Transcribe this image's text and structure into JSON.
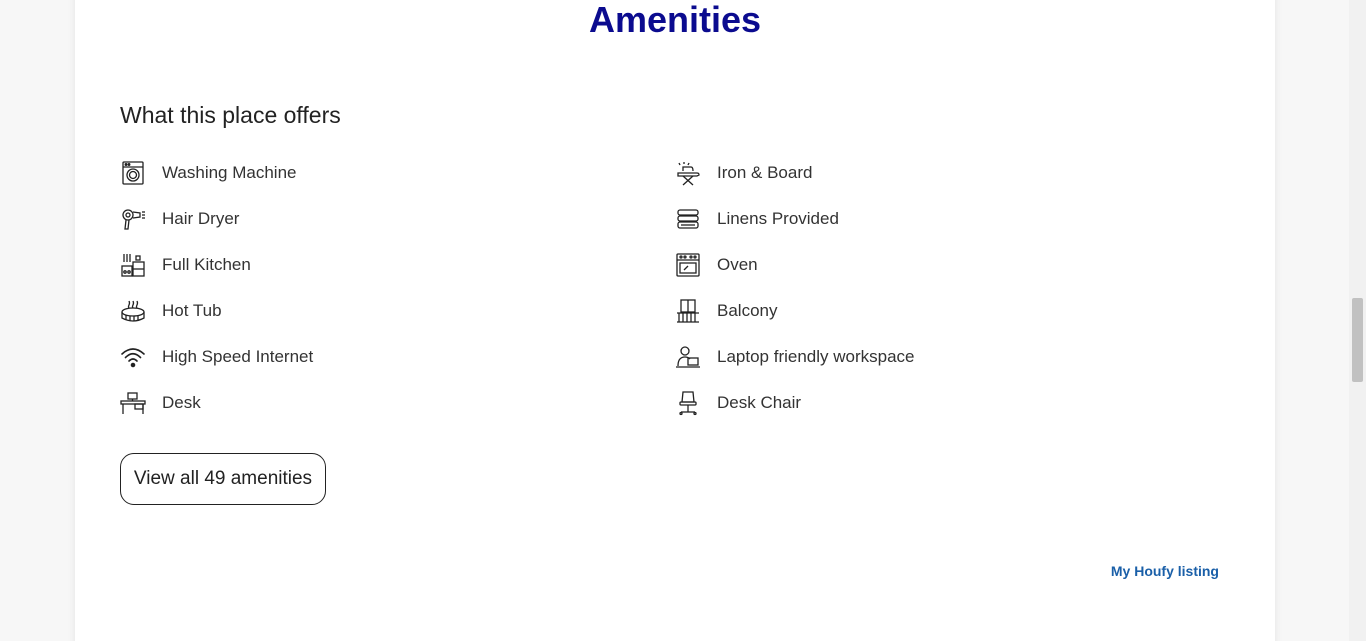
{
  "section": {
    "title": "Amenities",
    "subtitle": "What this place offers"
  },
  "amenities": [
    {
      "label": "Washing Machine",
      "icon": "washing-machine-icon"
    },
    {
      "label": "Iron & Board",
      "icon": "iron-board-icon"
    },
    {
      "label": "Hair Dryer",
      "icon": "hair-dryer-icon"
    },
    {
      "label": "Linens Provided",
      "icon": "linens-icon"
    },
    {
      "label": "Full Kitchen",
      "icon": "kitchen-icon"
    },
    {
      "label": "Oven",
      "icon": "oven-icon"
    },
    {
      "label": "Hot Tub",
      "icon": "hot-tub-icon"
    },
    {
      "label": "Balcony",
      "icon": "balcony-icon"
    },
    {
      "label": "High Speed Internet",
      "icon": "wifi-icon"
    },
    {
      "label": "Laptop friendly workspace",
      "icon": "laptop-workspace-icon"
    },
    {
      "label": "Desk",
      "icon": "desk-icon"
    },
    {
      "label": "Desk Chair",
      "icon": "desk-chair-icon"
    }
  ],
  "view_all_label": "View all 49 amenities",
  "listing_link": "My Houfy listing",
  "colors": {
    "title": "#0b0b8f",
    "link": "#1a5fa8",
    "text": "#333333"
  }
}
